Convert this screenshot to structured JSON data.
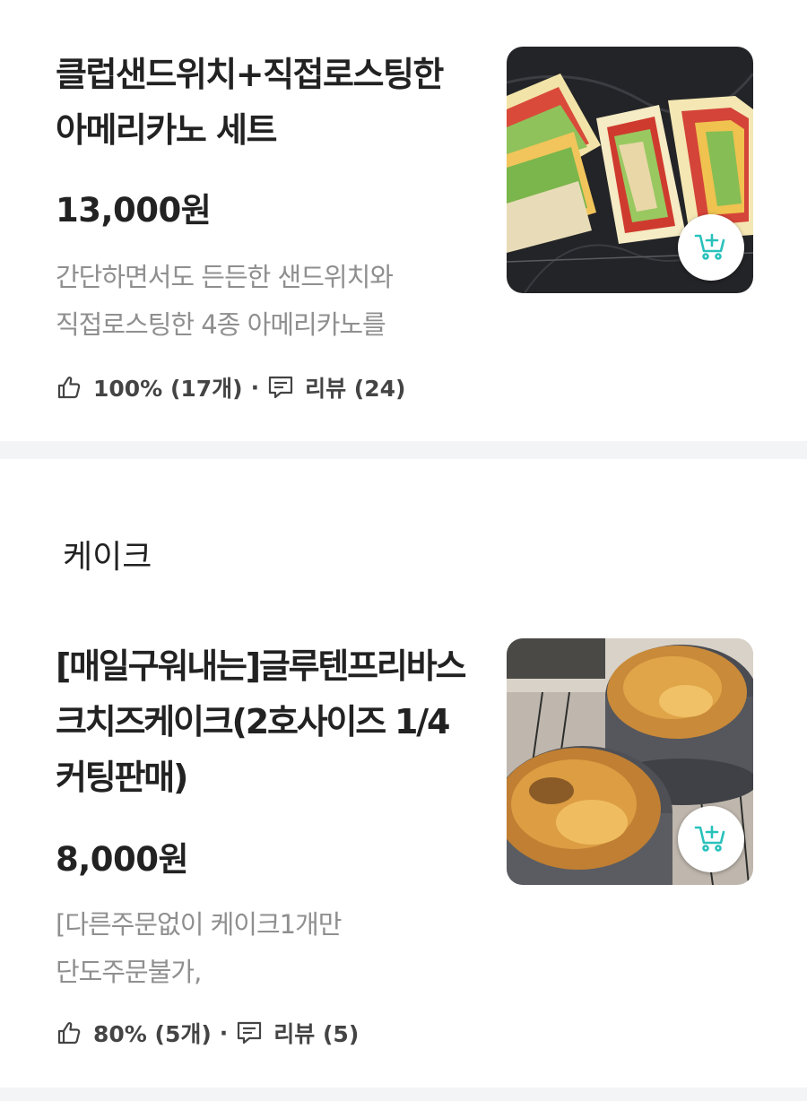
{
  "menu_items": [
    {
      "title": "클럽샌드위치+직접로스팅한 아메리카노 세트",
      "price": "13,000원",
      "description_lines": [
        "간단하면서도 든든한 샌드위치와",
        "직접로스팅한 4종 아메리카노를"
      ],
      "rating": "100% (17개)",
      "reviews": "리뷰 (24)",
      "image_icon": "sandwich-photo",
      "cart_icon": "add-to-cart-icon"
    },
    {
      "title": "[매일구워내는]글루텐프리바스크치즈케이크(2호사이즈 1/4커팅판매)",
      "price": "8,000원",
      "description_lines": [
        "[다른주문없이 케이크1개만",
        "단도주문불가,"
      ],
      "rating": "80% (5개)",
      "reviews": "리뷰 (5)",
      "image_icon": "cheesecake-photo",
      "cart_icon": "add-to-cart-icon"
    }
  ],
  "section": {
    "title": "케이크"
  },
  "separator": "·",
  "colors": {
    "cart_accent": "#2ac1bc",
    "muted_text": "#8f8f8f",
    "separator_bg": "#f3f4f6"
  }
}
